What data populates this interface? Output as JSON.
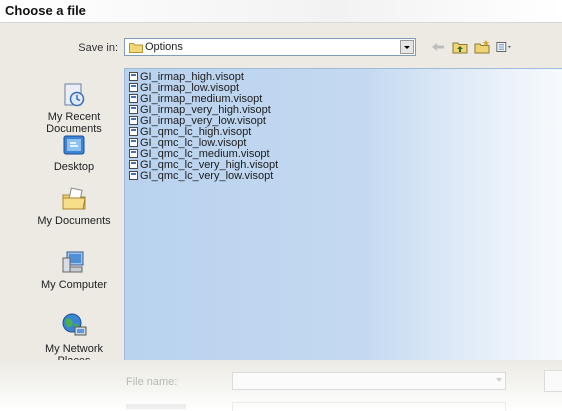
{
  "window": {
    "title": "Choose a file"
  },
  "save_in": {
    "label": "Save in:",
    "value": "Options"
  },
  "places": [
    {
      "key": "recent",
      "label": "My Recent Documents"
    },
    {
      "key": "desktop",
      "label": "Desktop"
    },
    {
      "key": "documents",
      "label": "My Documents"
    },
    {
      "key": "computer",
      "label": "My Computer"
    },
    {
      "key": "network",
      "label": "My Network Places"
    }
  ],
  "files": [
    "GI_irmap_high.visopt",
    "GI_irmap_low.visopt",
    "GI_irmap_medium.visopt",
    "GI_irmap_very_high.visopt",
    "GI_irmap_very_low.visopt",
    "GI_qmc_lc_high.visopt",
    "GI_qmc_lc_low.visopt",
    "GI_qmc_lc_medium.visopt",
    "GI_qmc_lc_very_high.visopt",
    "GI_qmc_lc_very_low.visopt"
  ],
  "file_name": {
    "label": "File name:",
    "value": ""
  },
  "colors": {
    "list_bg": "#c4d9f1",
    "dialog_bg": "#eceae3",
    "accent": "#4a6fb5"
  }
}
